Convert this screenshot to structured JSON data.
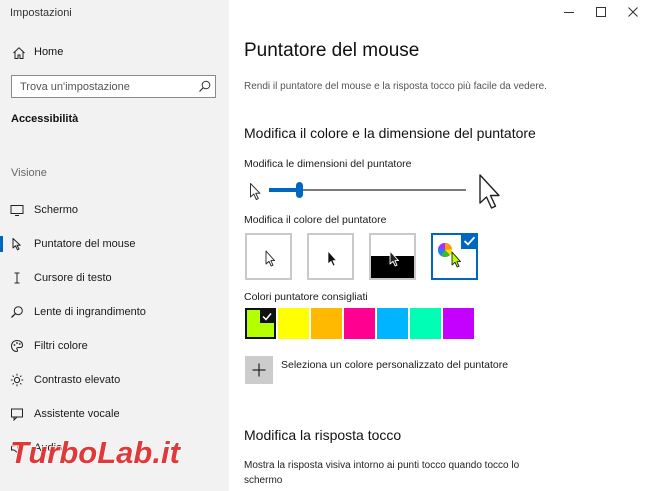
{
  "window": {
    "title": "Impostazioni",
    "controls": [
      "minimize",
      "maximize",
      "close"
    ]
  },
  "sidebar": {
    "home_label": "Home",
    "search_placeholder": "Trova un'impostazione",
    "section_title": "Accessibilità",
    "group_label": "Visione",
    "items": [
      {
        "label": "Schermo",
        "icon": "display-icon",
        "active": false
      },
      {
        "label": "Puntatore del mouse",
        "icon": "pointer-icon",
        "active": true
      },
      {
        "label": "Cursore di testo",
        "icon": "text-cursor-icon",
        "active": false
      },
      {
        "label": "Lente di ingrandimento",
        "icon": "magnifier-icon",
        "active": false
      },
      {
        "label": "Filtri colore",
        "icon": "palette-icon",
        "active": false
      },
      {
        "label": "Contrasto elevato",
        "icon": "contrast-icon",
        "active": false
      },
      {
        "label": "Assistente vocale",
        "icon": "narrator-icon",
        "active": false
      },
      {
        "label": "Audio",
        "icon": "speaker-icon",
        "active": false
      }
    ]
  },
  "main": {
    "title": "Puntatore del mouse",
    "description": "Rendi il puntatore del mouse e la risposta tocco più facile da vedere.",
    "pointer_section": {
      "heading": "Modifica il colore e la dimensione del puntatore",
      "size_label": "Modifica le dimensioni del puntatore",
      "size_level": 0.15,
      "color_label": "Modifica il colore del puntatore",
      "color_options": [
        {
          "name": "white",
          "selected": false
        },
        {
          "name": "black",
          "selected": false
        },
        {
          "name": "inverted",
          "selected": false
        },
        {
          "name": "custom",
          "selected": true
        }
      ],
      "suggested_label": "Colori puntatore consigliati",
      "suggested_colors": [
        "#b4ff00",
        "#ffff00",
        "#ffb900",
        "#ff0090",
        "#00b4ff",
        "#00ffb4",
        "#c400ff"
      ],
      "selected_color_index": 0,
      "custom_color_label": "Seleziona un colore personalizzato del puntatore"
    },
    "touch_section": {
      "heading": "Modifica la risposta tocco",
      "description": "Mostra la risposta visiva intorno ai punti tocco quando tocco lo schermo"
    }
  },
  "watermark": {
    "text": "TurboLab.it"
  },
  "colors": {
    "accent": "#0067c0",
    "sidebar_bg": "#f2f2f2",
    "watermark_red": "#e03030"
  }
}
